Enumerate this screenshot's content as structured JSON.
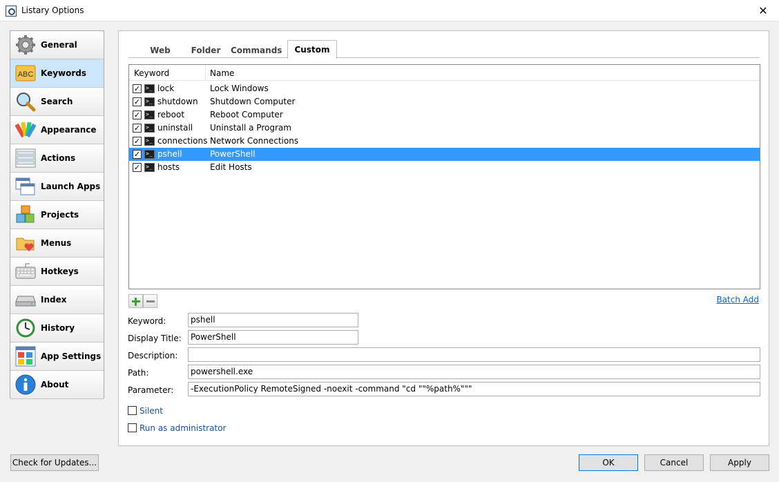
{
  "window": {
    "title": "Listary Options",
    "close_glyph": "✕"
  },
  "sidebar": {
    "items": [
      {
        "label": "General",
        "icon": "gear-icon"
      },
      {
        "label": "Keywords",
        "icon": "abc-icon",
        "selected": true
      },
      {
        "label": "Search",
        "icon": "magnifier-icon"
      },
      {
        "label": "Appearance",
        "icon": "palette-icon"
      },
      {
        "label": "Actions",
        "icon": "actions-icon"
      },
      {
        "label": "Launch Apps",
        "icon": "windows-icon"
      },
      {
        "label": "Projects",
        "icon": "boxes-icon"
      },
      {
        "label": "Menus",
        "icon": "folder-heart-icon"
      },
      {
        "label": "Hotkeys",
        "icon": "keyboard-icon"
      },
      {
        "label": "Index",
        "icon": "drive-icon"
      },
      {
        "label": "History",
        "icon": "clock-icon"
      },
      {
        "label": "App Settings",
        "icon": "tiles-icon"
      },
      {
        "label": "About",
        "icon": "info-icon"
      }
    ]
  },
  "tabs": [
    {
      "label": "Web"
    },
    {
      "label": "Folder"
    },
    {
      "label": "Commands"
    },
    {
      "label": "Custom",
      "active": true
    }
  ],
  "table": {
    "columns": [
      "Keyword",
      "Name"
    ],
    "rows": [
      {
        "keyword": "lock",
        "name": "Lock Windows",
        "checked": true
      },
      {
        "keyword": "shutdown",
        "name": "Shutdown Computer",
        "checked": true
      },
      {
        "keyword": "reboot",
        "name": "Reboot Computer",
        "checked": true
      },
      {
        "keyword": "uninstall",
        "name": "Uninstall a Program",
        "checked": true
      },
      {
        "keyword": "connections",
        "name": "Network Connections",
        "checked": true
      },
      {
        "keyword": "pshell",
        "name": "PowerShell",
        "checked": true,
        "selected": true
      },
      {
        "keyword": "hosts",
        "name": "Edit Hosts",
        "checked": true
      }
    ],
    "check_glyph": "✓",
    "cmd_glyph": ">_"
  },
  "batch_add": "Batch Add",
  "form": {
    "keyword": {
      "label": "Keyword:",
      "value": "pshell"
    },
    "display_title": {
      "label": "Display Title:",
      "value": "PowerShell"
    },
    "description": {
      "label": "Description:",
      "value": ""
    },
    "path": {
      "label": "Path:",
      "value": "powershell.exe"
    },
    "parameter": {
      "label": "Parameter:",
      "value": "-ExecutionPolicy RemoteSigned -noexit -command \"cd \"\"%path%\"\"\""
    }
  },
  "options": {
    "silent": "Silent",
    "run_as_admin": "Run as administrator"
  },
  "buttons": {
    "check_updates": "Check for Updates...",
    "ok": "OK",
    "cancel": "Cancel",
    "apply": "Apply"
  },
  "colors": {
    "selection": "#3399ff",
    "sidebar_selected": "#cde6fb",
    "link": "#0066cc"
  }
}
